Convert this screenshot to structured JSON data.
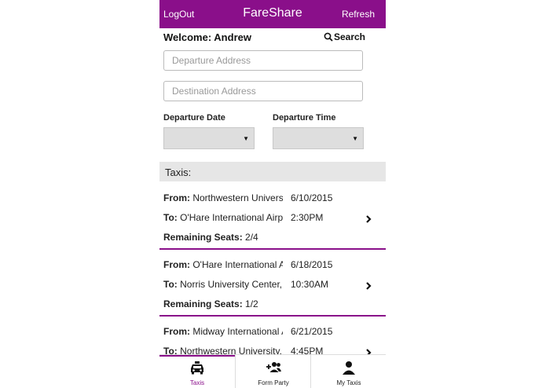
{
  "header": {
    "logout": "LogOut",
    "title": "FareShare",
    "refresh": "Refresh"
  },
  "welcome": "Welcome: Andrew",
  "search_label": "Search",
  "form": {
    "departure_placeholder": "Departure Address",
    "destination_placeholder": "Destination Address",
    "departure_date_label": "Departure Date",
    "departure_time_label": "Departure Time",
    "departure_date_value": "",
    "departure_time_value": ""
  },
  "taxis_header": "Taxis:",
  "labels": {
    "from": "From:",
    "to": "To:",
    "seats": "Remaining Seats:"
  },
  "taxis": [
    {
      "from": "Northwestern University",
      "to": "O'Hare International Airport",
      "date": "6/10/2015",
      "time": "2:30PM",
      "seats": "2/4"
    },
    {
      "from": "O'Hare International Airport",
      "to": "Norris University Center,",
      "date": "6/18/2015",
      "time": "10:30AM",
      "seats": "1/2"
    },
    {
      "from": "Midway International Airport",
      "to": "Northwestern University,",
      "date": "6/21/2015",
      "time": "4:45PM",
      "seats": ""
    }
  ],
  "tabs": [
    {
      "label": "Taxis",
      "icon": "taxi-icon",
      "active": true
    },
    {
      "label": "Form Party",
      "icon": "add-group-icon",
      "active": false
    },
    {
      "label": "My Taxis",
      "icon": "person-icon",
      "active": false
    }
  ],
  "colors": {
    "accent": "#8a0f8a",
    "header_bg": "#e6e6e6",
    "select_bg": "#dedede"
  }
}
